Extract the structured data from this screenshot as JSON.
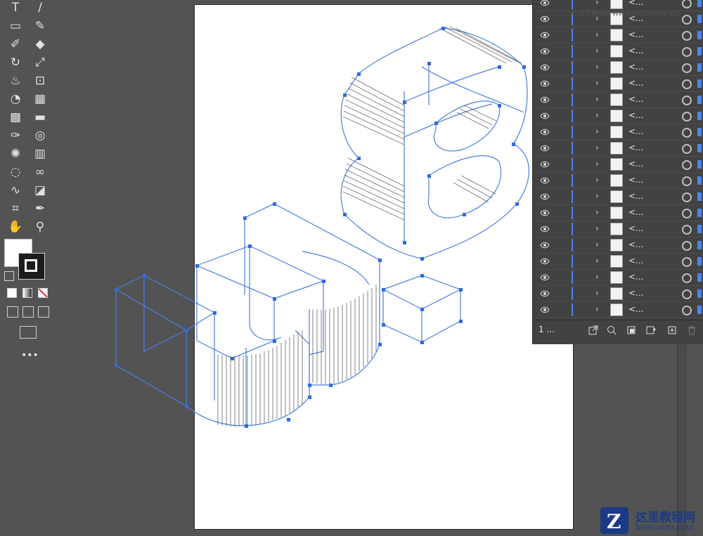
{
  "toolbar": {
    "tools": [
      {
        "name": "type-tool-icon",
        "col": 0,
        "row": 0,
        "glyph": "T"
      },
      {
        "name": "line-tool-icon",
        "col": 1,
        "row": 0,
        "glyph": "/"
      },
      {
        "name": "rectangle-tool-icon",
        "col": 0,
        "row": 1,
        "glyph": "▭"
      },
      {
        "name": "paintbrush-tool-icon",
        "col": 1,
        "row": 1,
        "glyph": "✎"
      },
      {
        "name": "shaper-tool-icon",
        "col": 0,
        "row": 2,
        "glyph": "✐"
      },
      {
        "name": "eraser-tool-icon",
        "col": 1,
        "row": 2,
        "glyph": "◆"
      },
      {
        "name": "rotate-tool-icon",
        "col": 0,
        "row": 3,
        "glyph": "↻"
      },
      {
        "name": "scale-tool-icon",
        "col": 1,
        "row": 3,
        "glyph": "⤢"
      },
      {
        "name": "warp-tool-icon",
        "col": 0,
        "row": 4,
        "glyph": "♨"
      },
      {
        "name": "free-transform-tool-icon",
        "col": 1,
        "row": 4,
        "glyph": "⊡"
      },
      {
        "name": "shape-builder-tool-icon",
        "col": 0,
        "row": 5,
        "glyph": "◔"
      },
      {
        "name": "perspective-grid-tool-icon",
        "col": 1,
        "row": 5,
        "glyph": "▦"
      },
      {
        "name": "mesh-tool-icon",
        "col": 0,
        "row": 6,
        "glyph": "▩"
      },
      {
        "name": "gradient-tool-icon",
        "col": 1,
        "row": 6,
        "glyph": "▬"
      },
      {
        "name": "eyedropper-tool-icon",
        "col": 0,
        "row": 7,
        "glyph": "✑"
      },
      {
        "name": "blend-tool-icon",
        "col": 1,
        "row": 7,
        "glyph": "◎"
      },
      {
        "name": "symbol-sprayer-tool-icon",
        "col": 0,
        "row": 8,
        "glyph": "✺"
      },
      {
        "name": "column-graph-tool-icon",
        "col": 1,
        "row": 8,
        "glyph": "▥"
      },
      {
        "name": "artboard-tool-icon",
        "col": 0,
        "row": 9,
        "glyph": "◌"
      },
      {
        "name": "slice-tool-icon",
        "col": 1,
        "row": 9,
        "glyph": "∞"
      },
      {
        "name": "curvature-tool-icon",
        "col": 0,
        "row": 10,
        "glyph": "∿"
      },
      {
        "name": "live-paint-tool-icon",
        "col": 1,
        "row": 10,
        "glyph": "◪"
      },
      {
        "name": "crop-tool-icon",
        "col": 0,
        "row": 11,
        "glyph": "⌗"
      },
      {
        "name": "pen-tool-icon",
        "col": 1,
        "row": 11,
        "glyph": "✒"
      },
      {
        "name": "hand-tool-icon",
        "col": 0,
        "row": 12,
        "glyph": "✋"
      },
      {
        "name": "zoom-tool-icon",
        "col": 1,
        "row": 12,
        "glyph": "⚲"
      }
    ],
    "more_tools": "•••"
  },
  "layers_panel": {
    "layer_name": "<...",
    "rows": 20,
    "footer_count": "1 ..."
  },
  "watermarks": {
    "top": "PS设计教程网 WWW.MISSVUAN.NET",
    "brand_title": "这里教程网",
    "brand_url": "herecours.com",
    "brand_logo": "Z"
  },
  "colors": {
    "panel_bg": "#535353",
    "layers_bg": "#424242",
    "accent": "#4a86e8",
    "path_stroke": "#4a7fe0"
  }
}
